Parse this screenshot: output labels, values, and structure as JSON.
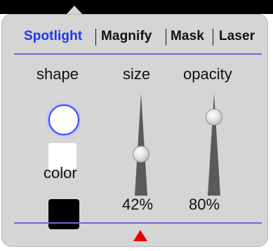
{
  "tabs": [
    {
      "label": "Spotlight",
      "active": true
    },
    {
      "label": "Magnify",
      "active": false
    },
    {
      "label": "Mask",
      "active": false
    },
    {
      "label": "Laser",
      "active": false
    }
  ],
  "labels": {
    "shape": "shape",
    "size": "size",
    "opacity": "opacity",
    "color": "color"
  },
  "sliders": {
    "size": {
      "value": 0.42,
      "display": "42%"
    },
    "opacity": {
      "value": 0.8,
      "display": "80%"
    }
  },
  "colors": {
    "active_tab": "#1a37ff",
    "accent_rule": "#6c67e4",
    "selected_color": "#000000",
    "panel_bg": "#d5d5d5",
    "pointer_arrow": "#ee0000"
  },
  "icons": {
    "selected_shape": "circle-shape-icon",
    "alt_shape": "square-shape-icon",
    "bottom_pointer": "red-triangle-up-icon"
  }
}
